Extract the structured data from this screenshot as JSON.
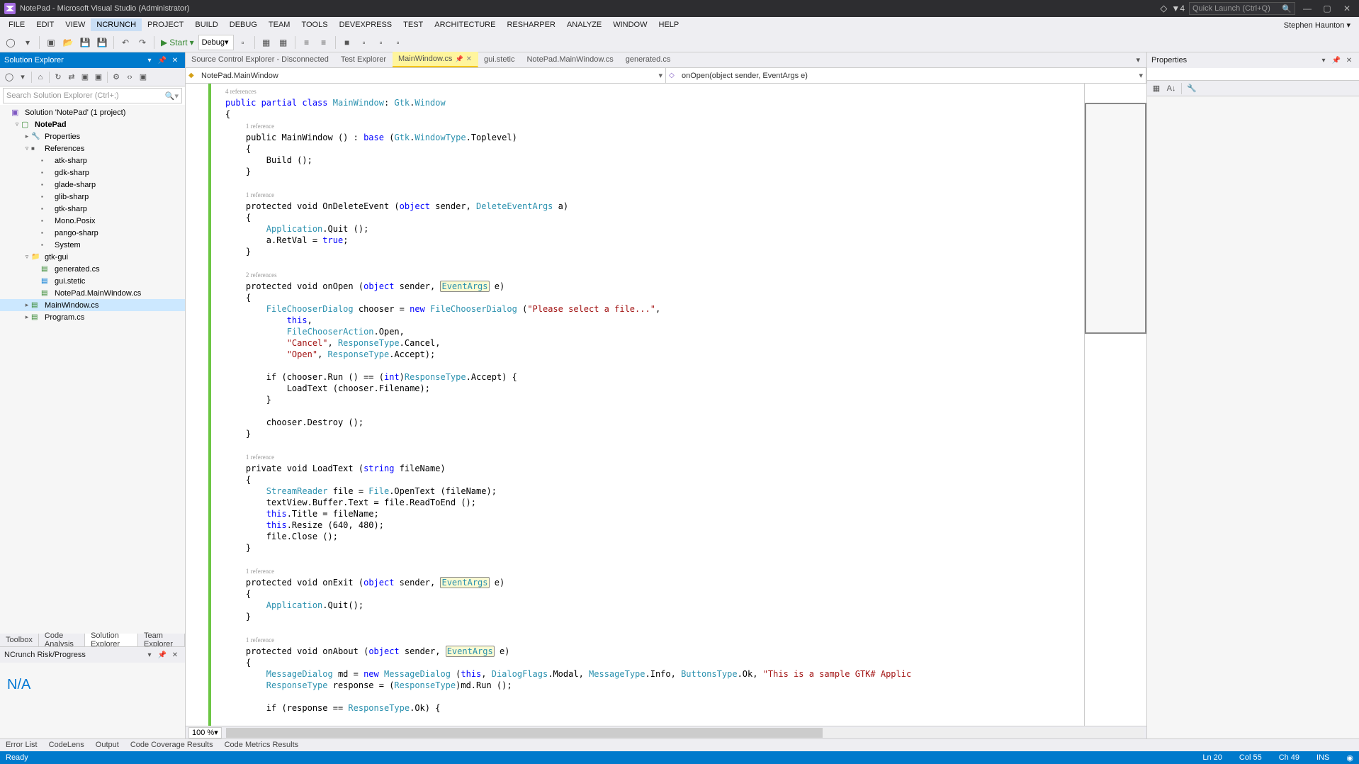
{
  "title": "NotePad - Microsoft Visual Studio  (Administrator)",
  "quick_launch_placeholder": "Quick Launch (Ctrl+Q)",
  "notification_count": "4",
  "menu": [
    "FILE",
    "EDIT",
    "VIEW",
    "NCRUNCH",
    "PROJECT",
    "BUILD",
    "DEBUG",
    "TEAM",
    "TOOLS",
    "DEVEXPRESS",
    "TEST",
    "ARCHITECTURE",
    "RESHARPER",
    "ANALYZE",
    "WINDOW",
    "HELP"
  ],
  "menu_active_index": 3,
  "user": "Stephen Haunton ▾",
  "toolbar": {
    "start": "Start",
    "config": "Debug"
  },
  "solution_explorer": {
    "title": "Solution Explorer",
    "search_placeholder": "Search Solution Explorer (Ctrl+;)",
    "tabs": [
      "Toolbox",
      "Code Analysis",
      "Solution Explorer",
      "Team Explorer"
    ],
    "tabs_active_index": 2,
    "tree": [
      {
        "d": 0,
        "tw": "",
        "ic": "sln",
        "lbl": "Solution 'NotePad' (1 project)"
      },
      {
        "d": 1,
        "tw": "▿",
        "ic": "proj",
        "lbl": "NotePad",
        "bold": true
      },
      {
        "d": 2,
        "tw": "▸",
        "ic": "props",
        "lbl": "Properties"
      },
      {
        "d": 2,
        "tw": "▿",
        "ic": "refs",
        "lbl": "References"
      },
      {
        "d": 3,
        "tw": "",
        "ic": "ref",
        "lbl": "atk-sharp"
      },
      {
        "d": 3,
        "tw": "",
        "ic": "ref",
        "lbl": "gdk-sharp"
      },
      {
        "d": 3,
        "tw": "",
        "ic": "ref",
        "lbl": "glade-sharp"
      },
      {
        "d": 3,
        "tw": "",
        "ic": "ref",
        "lbl": "glib-sharp"
      },
      {
        "d": 3,
        "tw": "",
        "ic": "ref",
        "lbl": "gtk-sharp"
      },
      {
        "d": 3,
        "tw": "",
        "ic": "ref",
        "lbl": "Mono.Posix"
      },
      {
        "d": 3,
        "tw": "",
        "ic": "ref",
        "lbl": "pango-sharp"
      },
      {
        "d": 3,
        "tw": "",
        "ic": "ref",
        "lbl": "System"
      },
      {
        "d": 2,
        "tw": "▿",
        "ic": "folder",
        "lbl": "gtk-gui"
      },
      {
        "d": 3,
        "tw": "",
        "ic": "cs",
        "lbl": "generated.cs"
      },
      {
        "d": 3,
        "tw": "",
        "ic": "file",
        "lbl": "gui.stetic"
      },
      {
        "d": 3,
        "tw": "",
        "ic": "cs",
        "lbl": "NotePad.MainWindow.cs"
      },
      {
        "d": 2,
        "tw": "▸",
        "ic": "cs",
        "lbl": "MainWindow.cs",
        "sel": true
      },
      {
        "d": 2,
        "tw": "▸",
        "ic": "cs",
        "lbl": "Program.cs"
      }
    ]
  },
  "ncrunch_panel": {
    "title": "NCrunch Risk/Progress",
    "value": "N/A"
  },
  "doc_tabs": [
    {
      "label": "Source Control Explorer - Disconnected"
    },
    {
      "label": "Test Explorer"
    },
    {
      "label": "MainWindow.cs",
      "active": true,
      "pinned": true
    },
    {
      "label": "gui.stetic"
    },
    {
      "label": "NotePad.MainWindow.cs"
    },
    {
      "label": "generated.cs"
    }
  ],
  "nav": {
    "left": "NotePad.MainWindow",
    "right": "onOpen(object sender, EventArgs e)"
  },
  "zoom": "100 %",
  "properties_title": "Properties",
  "bottom_tabs": [
    "Error List",
    "CodeLens",
    "Output",
    "Code Coverage Results",
    "Code Metrics Results"
  ],
  "status": {
    "left": "Ready",
    "ln": "Ln 20",
    "col": "Col 55",
    "ch": "Ch 49",
    "ins": "INS"
  },
  "code": {
    "l0": "4 references",
    "l1a": "public partial class ",
    "l1b": "MainWindow",
    "l1c": ": ",
    "l1d": "Gtk",
    "l1e": ".",
    "l1f": "Window",
    "l2": "{",
    "l3": "1 reference",
    "l4a": "    public MainWindow () : ",
    "l4b": "base",
    "l4c": " (",
    "l4d": "Gtk",
    "l4e": ".",
    "l4f": "WindowType",
    "l4g": ".Toplevel)",
    "l5": "    {",
    "l6": "        Build ();",
    "l7": "    }",
    "l8": "",
    "l9": "1 reference",
    "l10a": "    protected void OnDeleteEvent (",
    "l10b": "object",
    "l10c": " sender, ",
    "l10d": "DeleteEventArgs",
    "l10e": " a)",
    "l11": "    {",
    "l12a": "        ",
    "l12b": "Application",
    "l12c": ".Quit ();",
    "l13a": "        a.RetVal = ",
    "l13b": "true",
    "l13c": ";",
    "l14": "    }",
    "l15": "",
    "l16": "2 references",
    "l17a": "    protected void ",
    "l17b": "onOpen",
    "l17c": " (",
    "l17d": "object",
    "l17e": " sender, ",
    "l17f": "EventArgs",
    "l17g": " e)",
    "l18": "    {",
    "l19a": "        ",
    "l19b": "FileChooserDialog",
    "l19c": " chooser = ",
    "l19d": "new",
    "l19e": " ",
    "l19f": "FileChooserDialog",
    "l19g": " (",
    "l19h": "\"Please select a file...\"",
    "l19i": ",",
    "l20a": "            ",
    "l20b": "this",
    "l20c": ",",
    "l21a": "            ",
    "l21b": "FileChooserAction",
    "l21c": ".Open,",
    "l22a": "            ",
    "l22b": "\"Cancel\"",
    "l22c": ", ",
    "l22d": "ResponseType",
    "l22e": ".Cancel,",
    "l23a": "            ",
    "l23b": "\"Open\"",
    "l23c": ", ",
    "l23d": "ResponseType",
    "l23e": ".Accept);",
    "l24": "",
    "l25a": "        if (chooser.Run () == (",
    "l25a2": "int",
    "l25b": ")",
    "l25c": "ResponseType",
    "l25d": ".Accept) {",
    "l26": "            LoadText (chooser.Filename);",
    "l27": "        }",
    "l28": "",
    "l29": "        chooser.Destroy ();",
    "l30": "    }",
    "l31": "",
    "l32": "1 reference",
    "l33a": "    private void LoadText (",
    "l33b": "string",
    "l33c": " fileName)",
    "l34": "    {",
    "l35a": "        ",
    "l35b": "StreamReader",
    "l35c": " file = ",
    "l35d": "File",
    "l35e": ".OpenText (fileName);",
    "l36": "        textView.Buffer.Text = file.ReadToEnd ();",
    "l37a": "        ",
    "l37b": "this",
    "l37c": ".Title = fileName;",
    "l38a": "        ",
    "l38b": "this",
    "l38c": ".Resize (640, 480);",
    "l39": "        file.Close ();",
    "l40": "    }",
    "l41": "",
    "l42": "1 reference",
    "l43a": "    protected void ",
    "l43b": "onExit",
    "l43c": " (",
    "l43d": "object",
    "l43e": " sender, ",
    "l43f": "EventArgs",
    "l43g": " e)",
    "l44": "    {",
    "l45a": "        ",
    "l45b": "Application",
    "l45c": ".Quit();",
    "l46": "    }",
    "l47": "",
    "l48": "1 reference",
    "l49a": "    protected void ",
    "l49b": "onAbout",
    "l49c": " (",
    "l49d": "object",
    "l49e": " sender, ",
    "l49f": "EventArgs",
    "l49g": " e)",
    "l50": "    {",
    "l51a": "        ",
    "l51b": "MessageDialog",
    "l51c": " md = ",
    "l51d": "new",
    "l51e": " ",
    "l51f": "MessageDialog",
    "l51g": " (",
    "l51h": "this",
    "l51i": ", ",
    "l51j": "DialogFlags",
    "l51k": ".Modal, ",
    "l51l": "MessageType",
    "l51m": ".Info, ",
    "l51n": "ButtonsType",
    "l51o": ".Ok, ",
    "l51p": "\"This is a sample GTK# Applic",
    "l52a": "        ",
    "l52b": "ResponseType",
    "l52c": " response = (",
    "l52d": "ResponseType",
    "l52e": ")md.Run ();",
    "l53": "",
    "l54a": "        if (response == ",
    "l54b": "ResponseType",
    "l54c": ".Ok) {"
  }
}
